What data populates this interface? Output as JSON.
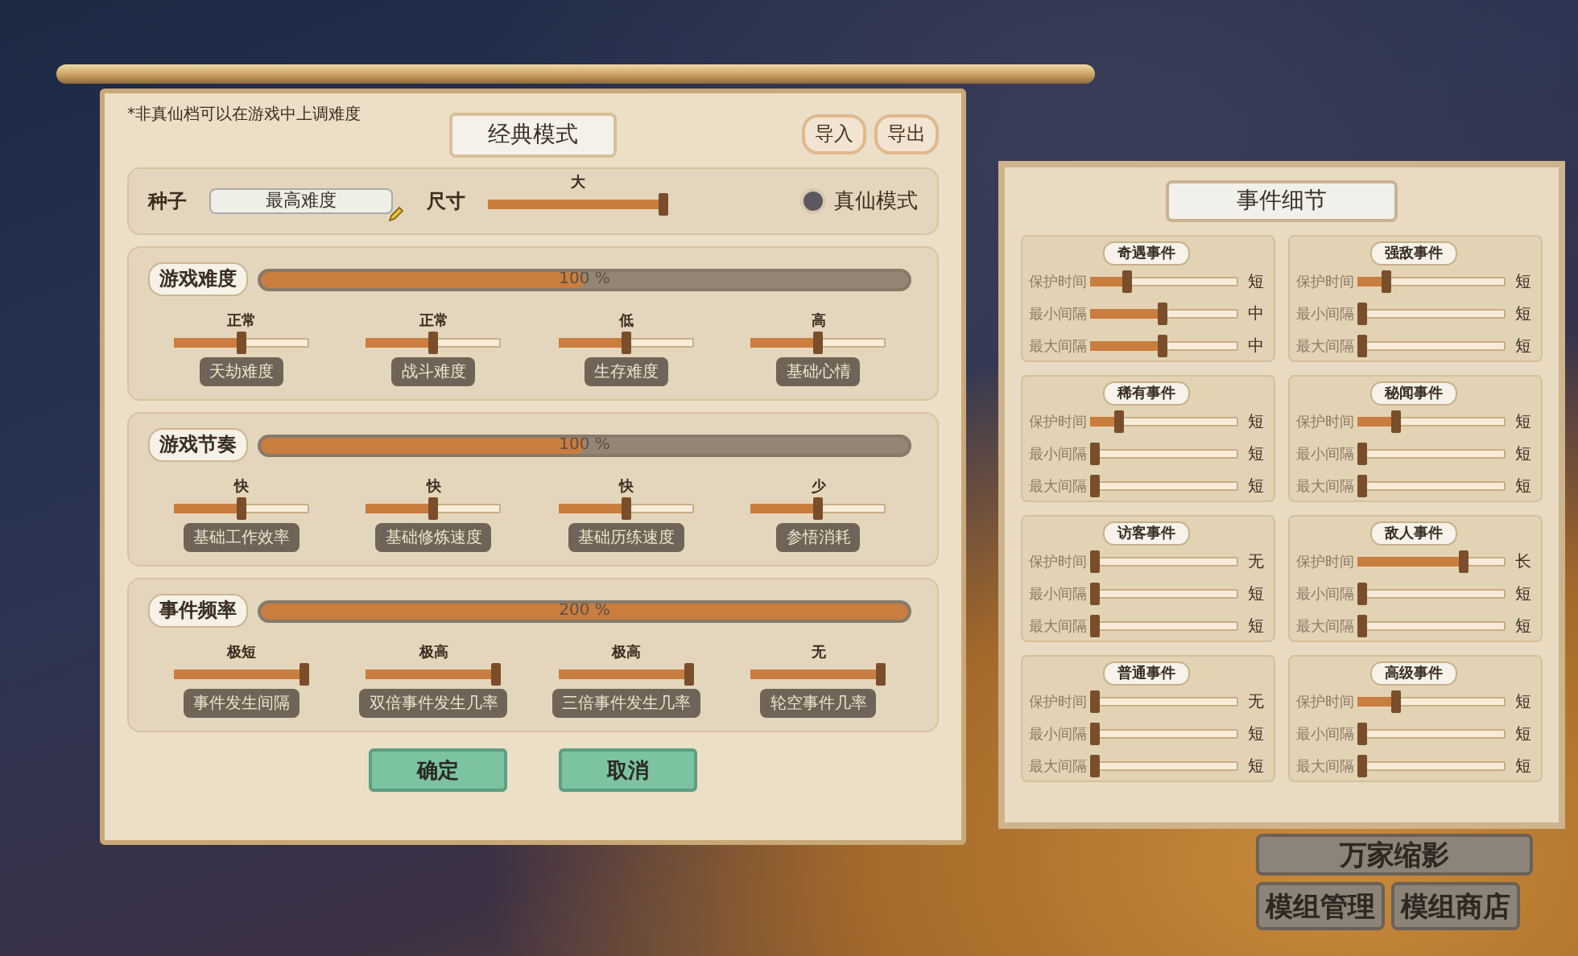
{
  "note": "*非真仙档可以在游戏中上调难度",
  "title": "经典模式",
  "header_buttons": [
    {
      "label": "导入"
    },
    {
      "label": "导出"
    }
  ],
  "seed": {
    "label": "种子",
    "value": "最高难度"
  },
  "size": {
    "label": "尺寸",
    "reading": "大",
    "level": 1
  },
  "true_immortal": {
    "label": "真仙模式",
    "checked": false
  },
  "sections": [
    {
      "title": "游戏难度",
      "level": 0.5,
      "reading": "100 %",
      "sliders": [
        {
          "reading": "正常",
          "level": 0.5,
          "label": "天劫难度"
        },
        {
          "reading": "正常",
          "level": 0.5,
          "label": "战斗难度"
        },
        {
          "reading": "低",
          "level": 0.5,
          "label": "生存难度"
        },
        {
          "reading": "高",
          "level": 0.5,
          "label": "基础心情"
        }
      ]
    },
    {
      "title": "游戏节奏",
      "level": 0.5,
      "reading": "100 %",
      "sliders": [
        {
          "reading": "快",
          "level": 0.5,
          "label": "基础工作效率"
        },
        {
          "reading": "快",
          "level": 0.5,
          "label": "基础修炼速度"
        },
        {
          "reading": "快",
          "level": 0.5,
          "label": "基础历练速度"
        },
        {
          "reading": "少",
          "level": 0.5,
          "label": "参悟消耗"
        }
      ]
    },
    {
      "title": "事件频率",
      "level": 1,
      "reading": "200 %",
      "sliders": [
        {
          "reading": "极短",
          "level": 1,
          "label": "事件发生间隔"
        },
        {
          "reading": "极高",
          "level": 1,
          "label": "双倍事件发生几率"
        },
        {
          "reading": "极高",
          "level": 1,
          "label": "三倍事件发生几率"
        },
        {
          "reading": "无",
          "level": 1,
          "label": "轮空事件几率"
        }
      ]
    }
  ],
  "buttons": [
    {
      "label": "确定"
    },
    {
      "label": "取消"
    }
  ],
  "events": {
    "title": "事件细节",
    "cards": [
      {
        "title": "奇遇事件",
        "rows": [
          {
            "label": "保护时间",
            "level": 0.23,
            "reading": "短"
          },
          {
            "label": "最小间隔",
            "level": 0.49,
            "reading": "中"
          },
          {
            "label": "最大间隔",
            "level": 0.49,
            "reading": "中"
          }
        ]
      },
      {
        "title": "强敌事件",
        "rows": [
          {
            "label": "保护时间",
            "level": 0.18,
            "reading": "短"
          },
          {
            "label": "最小间隔",
            "level": 0,
            "reading": "短"
          },
          {
            "label": "最大间隔",
            "level": 0,
            "reading": "短"
          }
        ]
      },
      {
        "title": "稀有事件",
        "rows": [
          {
            "label": "保护时间",
            "level": 0.18,
            "reading": "短"
          },
          {
            "label": "最小间隔",
            "level": 0,
            "reading": "短"
          },
          {
            "label": "最大间隔",
            "level": 0,
            "reading": "短"
          }
        ]
      },
      {
        "title": "秘闻事件",
        "rows": [
          {
            "label": "保护时间",
            "level": 0.24,
            "reading": "短"
          },
          {
            "label": "最小间隔",
            "level": 0,
            "reading": "短"
          },
          {
            "label": "最大间隔",
            "level": 0,
            "reading": "短"
          }
        ]
      },
      {
        "title": "访客事件",
        "rows": [
          {
            "label": "保护时间",
            "level": 0,
            "reading": "无"
          },
          {
            "label": "最小间隔",
            "level": 0,
            "reading": "短"
          },
          {
            "label": "最大间隔",
            "level": 0,
            "reading": "短"
          }
        ]
      },
      {
        "title": "敌人事件",
        "rows": [
          {
            "label": "保护时间",
            "level": 0.73,
            "reading": "长"
          },
          {
            "label": "最小间隔",
            "level": 0,
            "reading": "短"
          },
          {
            "label": "最大间隔",
            "level": 0,
            "reading": "短"
          }
        ]
      },
      {
        "title": "普通事件",
        "rows": [
          {
            "label": "保护时间",
            "level": 0,
            "reading": "无"
          },
          {
            "label": "最小间隔",
            "level": 0,
            "reading": "短"
          },
          {
            "label": "最大间隔",
            "level": 0,
            "reading": "短"
          }
        ]
      },
      {
        "title": "高级事件",
        "rows": [
          {
            "label": "保护时间",
            "level": 0.24,
            "reading": "短"
          },
          {
            "label": "最小间隔",
            "level": 0,
            "reading": "短"
          },
          {
            "label": "最大间隔",
            "level": 0,
            "reading": "短"
          }
        ]
      }
    ]
  },
  "side_buttons": [
    {
      "label": "万家缩影"
    },
    {
      "label": "模组管理"
    },
    {
      "label": "模组商店"
    }
  ]
}
